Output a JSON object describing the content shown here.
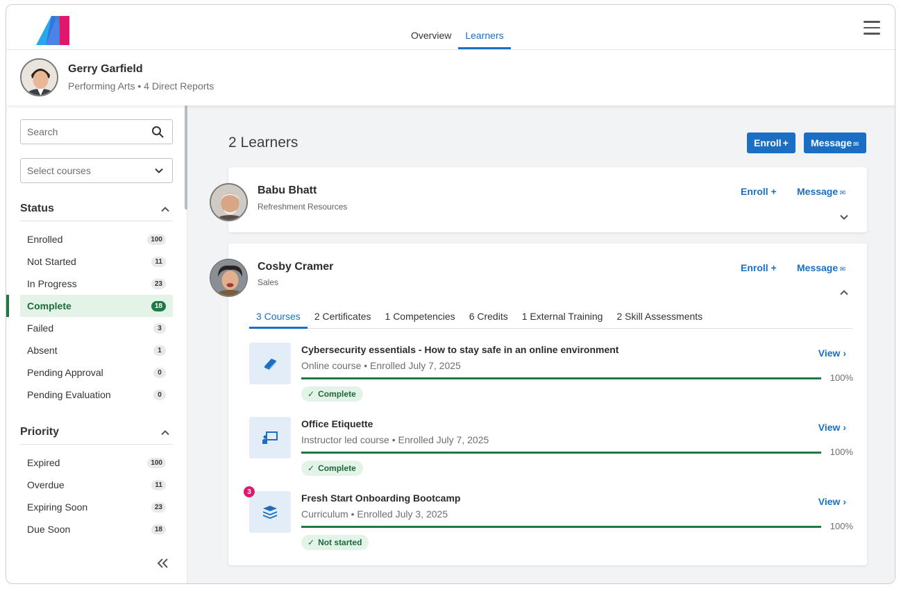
{
  "nav": {
    "tabs": [
      "Overview",
      "Learners"
    ],
    "active_tab": "Learners"
  },
  "profile": {
    "name": "Gerry Garfield",
    "subtitle": "Performing Arts • 4 Direct Reports"
  },
  "sidebar": {
    "search_placeholder": "Search",
    "select_placeholder": "Select courses",
    "status_title": "Status",
    "status_items": [
      {
        "label": "Enrolled",
        "count": "100"
      },
      {
        "label": "Not Started",
        "count": "11"
      },
      {
        "label": "In Progress",
        "count": "23"
      },
      {
        "label": "Complete",
        "count": "18"
      },
      {
        "label": "Failed",
        "count": "3"
      },
      {
        "label": "Absent",
        "count": "1"
      },
      {
        "label": "Pending Approval",
        "count": "0"
      },
      {
        "label": "Pending Evaluation",
        "count": "0"
      }
    ],
    "active_status": "Complete",
    "priority_title": "Priority",
    "priority_items": [
      {
        "label": "Expired",
        "count": "100"
      },
      {
        "label": "Overdue",
        "count": "11"
      },
      {
        "label": "Expiring Soon",
        "count": "23"
      },
      {
        "label": "Due Soon",
        "count": "18"
      }
    ]
  },
  "main": {
    "count_label": "2 Learners",
    "enroll_label": "Enroll",
    "message_label": "Message"
  },
  "learners": [
    {
      "name": "Babu Bhatt",
      "dept": "Refreshment Resources",
      "enroll": "Enroll",
      "message": "Message"
    },
    {
      "name": "Cosby Cramer",
      "dept": "Sales",
      "enroll": "Enroll",
      "message": "Message"
    }
  ],
  "tabs": [
    "3 Courses",
    "2 Certificates",
    "1 Competencies",
    "6 Credits",
    "1 External Training",
    "2 Skill Assessments"
  ],
  "active_tab": "3 Courses",
  "courses": [
    {
      "title": "Cybersecurity essentials - How to stay safe in an online environment",
      "meta": "Online course • Enrolled July 7, 2025",
      "progress": 100,
      "progress_label": "100%",
      "status": "Complete",
      "view": "View",
      "icon": "book-icon"
    },
    {
      "title": "Office Etiquette",
      "meta": "Instructor led course • Enrolled July 7, 2025",
      "progress": 100,
      "progress_label": "100%",
      "status": "Complete",
      "view": "View",
      "icon": "instructor-icon"
    },
    {
      "title": "Fresh Start Onboarding Bootcamp",
      "meta": "Curriculum • Enrolled July 3, 2025",
      "progress": 100,
      "progress_label": "100%",
      "status": "Not started",
      "view": "View",
      "icon": "stack-icon",
      "notification": "3"
    }
  ],
  "colors": {
    "accent": "#1a6fc4",
    "success": "#1d7a45",
    "success_bg": "#e4f3e8",
    "notification": "#e0186c"
  }
}
